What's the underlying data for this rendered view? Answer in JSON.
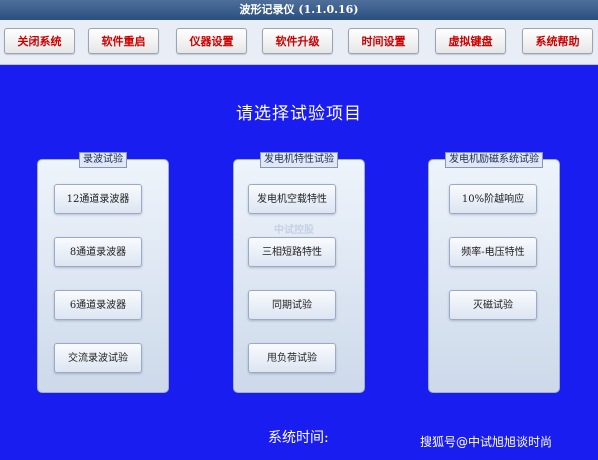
{
  "window": {
    "title": "波形记录仪 (1.1.0.16)"
  },
  "toolbar": {
    "buttons": [
      "关闭系统",
      "软件重启",
      "仪器设置",
      "软件升级",
      "时间设置",
      "虚拟键盘",
      "系统帮助"
    ]
  },
  "main": {
    "heading": "请选择试验项目",
    "panels": [
      {
        "title": "录波试验",
        "items": [
          "12通道录波器",
          "8通道录波器",
          "6通道录波器",
          "交流录波试验"
        ]
      },
      {
        "title": "发电机特性试验",
        "items": [
          "发电机空载特性",
          "三相短路特性",
          "同期试验",
          "甩负荷试验"
        ]
      },
      {
        "title": "发电机励磁系统试验",
        "items": [
          "10%阶越响应",
          "频率-电压特性",
          "灭磁试验"
        ]
      }
    ],
    "system_time_label": "系统时间:",
    "watermark_center": "中试控股",
    "watermark_corner": "搜狐号@中试旭旭谈时尚"
  },
  "colors": {
    "background": "#1a1df0",
    "button_text": "#cc0000"
  }
}
